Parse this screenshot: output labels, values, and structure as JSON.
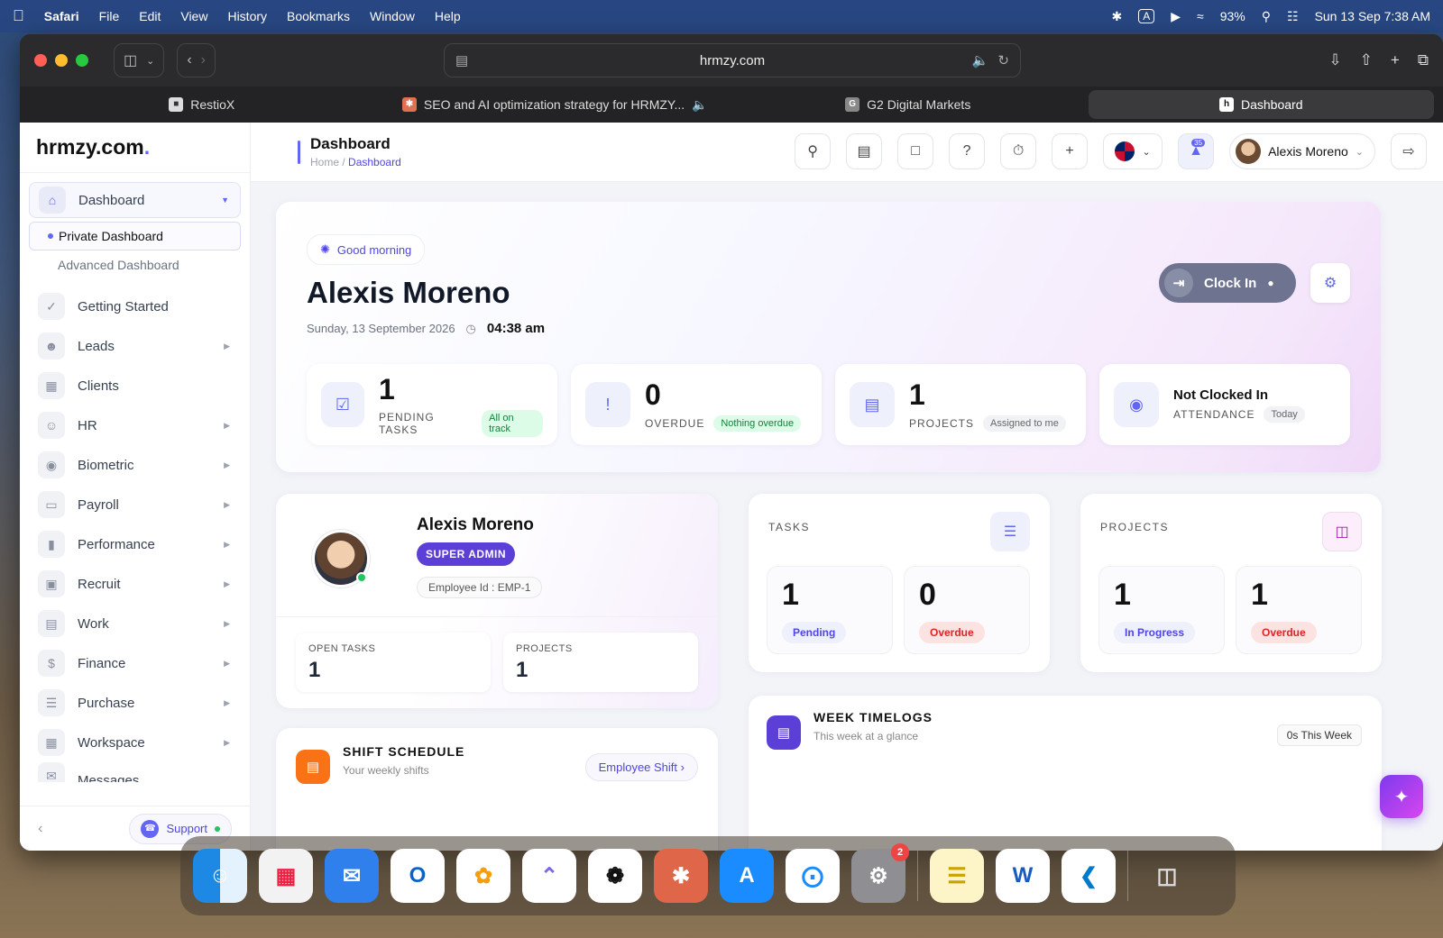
{
  "menubar": {
    "app": "Safari",
    "items": [
      "File",
      "Edit",
      "View",
      "History",
      "Bookmarks",
      "Window",
      "Help"
    ],
    "battery": "93%",
    "datetime": "Sun 13 Sep  7:38 AM"
  },
  "browser": {
    "url": "hrmzy.com",
    "tabs": [
      {
        "label": "RestioX"
      },
      {
        "label": "SEO and AI optimization strategy for HRMZY..."
      },
      {
        "label": "G2 Digital Markets"
      },
      {
        "label": "Dashboard"
      }
    ]
  },
  "sidebar": {
    "logo_text": "hrmzy.com",
    "active": "Dashboard",
    "sub_items": [
      "Private Dashboard",
      "Advanced Dashboard"
    ],
    "items": [
      "Getting Started",
      "Leads",
      "Clients",
      "HR",
      "Biometric",
      "Payroll",
      "Performance",
      "Recruit",
      "Work",
      "Finance",
      "Purchase",
      "Workspace",
      "Messages"
    ],
    "support": "Support"
  },
  "header": {
    "title": "Dashboard",
    "crumb_home": "Home",
    "crumb_sep": "/",
    "crumb_current": "Dashboard",
    "notifications": "35",
    "user": "Alexis Moreno"
  },
  "hero": {
    "greeting": "Good morning",
    "name": "Alexis Moreno",
    "date": "Sunday, 13 September 2026",
    "time": "04:38 am",
    "clock_in": "Clock In",
    "stats": [
      {
        "value": "1",
        "label": "PENDING TASKS",
        "pill": "All on track"
      },
      {
        "value": "0",
        "label": "OVERDUE",
        "pill": "Nothing overdue"
      },
      {
        "value": "1",
        "label": "PROJECTS",
        "pill": "Assigned to me"
      },
      {
        "value": "Not Clocked In",
        "label": "ATTENDANCE",
        "pill": "Today"
      }
    ]
  },
  "profile": {
    "name": "Alexis Moreno",
    "role": "SUPER ADMIN",
    "employee_id": "Employee Id : EMP-1",
    "open_tasks_label": "OPEN TASKS",
    "open_tasks": "1",
    "projects_label": "PROJECTS",
    "projects": "1"
  },
  "tasks_card": {
    "title": "TASKS",
    "boxes": [
      {
        "value": "1",
        "label": "Pending"
      },
      {
        "value": "0",
        "label": "Overdue"
      }
    ]
  },
  "projects_card": {
    "title": "PROJECTS",
    "boxes": [
      {
        "value": "1",
        "label": "In Progress"
      },
      {
        "value": "1",
        "label": "Overdue"
      }
    ]
  },
  "timelogs": {
    "title": "WEEK TIMELOGS",
    "subtitle": "This week at a glance",
    "badge": "0s This Week"
  },
  "shift": {
    "title": "SHIFT SCHEDULE",
    "subtitle": "Your weekly shifts",
    "link": "Employee Shift"
  },
  "dock": {
    "settings_badge": "2"
  }
}
